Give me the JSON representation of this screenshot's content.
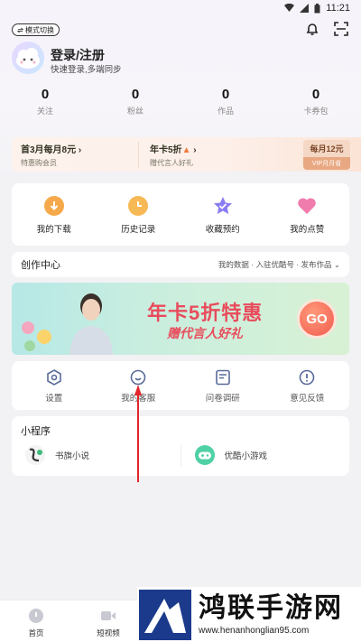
{
  "status_bar": {
    "time": "11:21"
  },
  "header": {
    "mode_switch": "模式切换"
  },
  "profile": {
    "login_title": "登录/注册",
    "login_sub": "快速登录,多端同步"
  },
  "stats": [
    {
      "value": "0",
      "label": "关注"
    },
    {
      "value": "0",
      "label": "粉丝"
    },
    {
      "value": "0",
      "label": "作品"
    },
    {
      "value": "0",
      "label": "卡券包"
    }
  ],
  "vip": {
    "offer1_title": "首3月每月8元",
    "offer1_sub": "特惠购会员",
    "offer2_title": "年卡5折",
    "offer2_sub": "赠代言人好礼",
    "badge_price": "每月12元",
    "badge_tag": "VIP月月省"
  },
  "quick_actions": [
    {
      "label": "我的下载",
      "icon": "download-icon",
      "color": "#f5a94a"
    },
    {
      "label": "历史记录",
      "icon": "clock-icon",
      "color": "#f7b955"
    },
    {
      "label": "收藏预约",
      "icon": "star-icon",
      "color": "#8a7cf2"
    },
    {
      "label": "我的点赞",
      "icon": "heart-icon",
      "color": "#f07cae"
    }
  ],
  "creation": {
    "title": "创作中心",
    "links": "我的数据 · 入驻优酷号 · 发布作品"
  },
  "banner": {
    "headline": "年卡5折特惠",
    "subline": "赠代言人好礼",
    "go": "GO"
  },
  "tools": [
    {
      "label": "设置",
      "icon": "settings-icon"
    },
    {
      "label": "我的客服",
      "icon": "customer-service-icon"
    },
    {
      "label": "问卷调研",
      "icon": "survey-icon"
    },
    {
      "label": "意见反馈",
      "icon": "feedback-icon"
    }
  ],
  "mini_programs": {
    "title": "小程序",
    "items": [
      {
        "label": "书旗小说",
        "icon": "shuqi-icon"
      },
      {
        "label": "优酷小游戏",
        "icon": "gamepad-icon"
      }
    ]
  },
  "bottom_nav": [
    {
      "label": "首页",
      "icon": "home-icon"
    },
    {
      "label": "短视频",
      "icon": "short-video-icon"
    }
  ],
  "watermark": {
    "brand": "鸿联手游网",
    "url": "www.henanhonglian95.com"
  }
}
